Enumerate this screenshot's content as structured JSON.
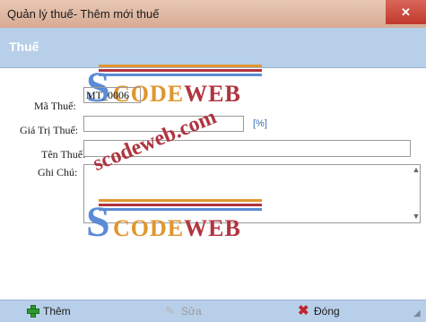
{
  "window": {
    "title": "Quản lý thuế- Thêm mới thuế",
    "close_glyph": "✕"
  },
  "panel": {
    "title": "Thuế"
  },
  "form": {
    "ma_thue_label": "Mã Thuế:",
    "ma_thue_value": "MT_0006",
    "gia_tri_label": "Giá Trị Thuế:",
    "gia_tri_value": "",
    "gia_tri_unit": "[%]",
    "ten_thue_label": "Tên Thuế:",
    "ten_thue_value": "",
    "ghi_chu_label": "Ghi Chú:",
    "ghi_chu_value": ""
  },
  "watermark": {
    "logo_s": "S",
    "logo_code": "CODE",
    "logo_web": "WEB",
    "url": "scodeweb.com"
  },
  "footer": {
    "add_label": "Thêm",
    "edit_label": "Sửa",
    "close_label": "Đóng"
  },
  "icons": {
    "add": "plus-icon",
    "edit": "pencil-icon",
    "close": "x-icon"
  },
  "colors": {
    "panel_header": "#b8cfe9",
    "title_bar": "#d8aa94",
    "close_button": "#c0392b",
    "unit_text": "#3a6fb5"
  }
}
